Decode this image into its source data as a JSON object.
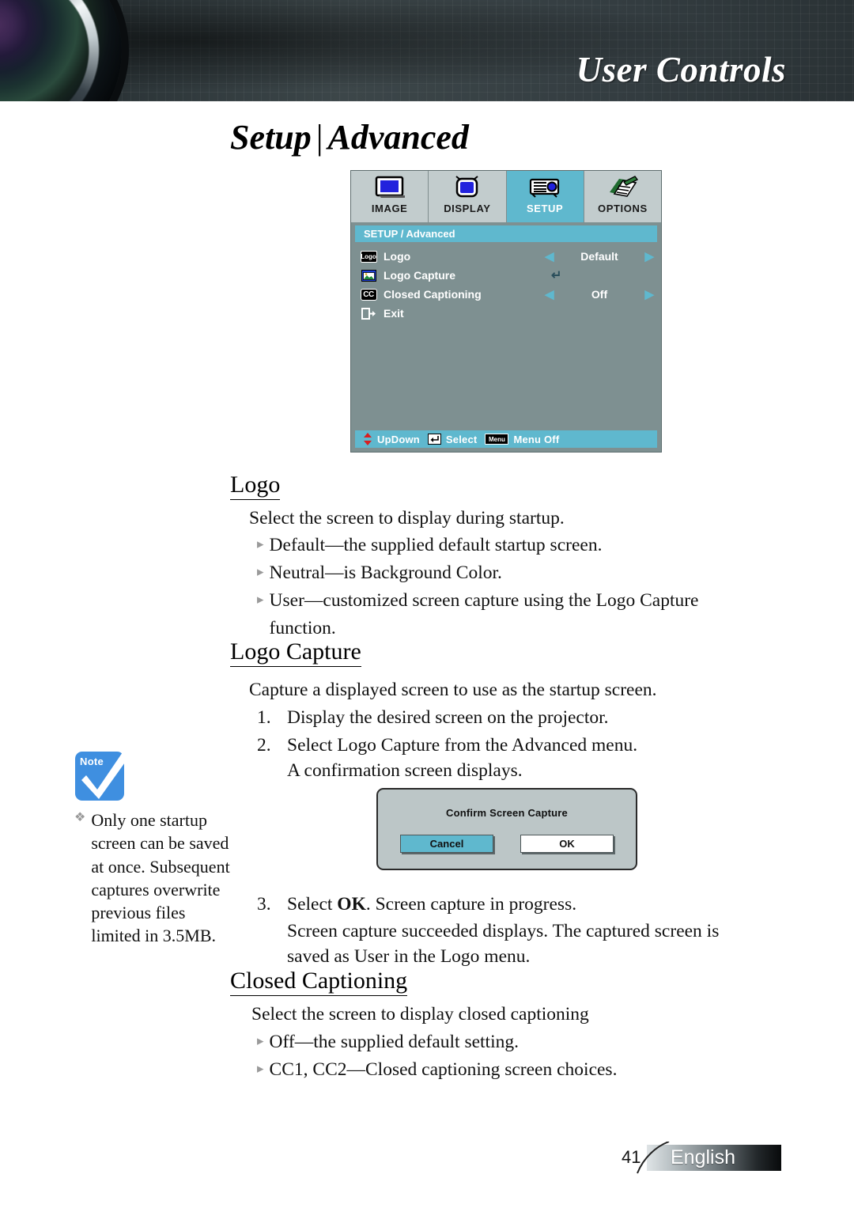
{
  "header": {
    "title": "User Controls",
    "lens_icon": "camera-lens-graphic"
  },
  "page": {
    "title_part1": "Setup",
    "title_separator": "|",
    "title_part2": "Advanced"
  },
  "osd": {
    "tabs": [
      {
        "label": "IMAGE",
        "icon": "monitor-icon",
        "active": false
      },
      {
        "label": "DISPLAY",
        "icon": "tv-icon",
        "active": false
      },
      {
        "label": "SETUP",
        "icon": "projector-icon",
        "active": true
      },
      {
        "label": "OPTIONS",
        "icon": "notes-pen-icon",
        "active": false
      }
    ],
    "breadcrumb": "SETUP / Advanced",
    "rows": [
      {
        "icon": "logo-icon",
        "label": "Logo",
        "control": "spinner",
        "value": "Default",
        "left_arrow": "◀",
        "right_arrow": "▶"
      },
      {
        "icon": "logo-capture-icon",
        "label": "Logo Capture",
        "control": "enter",
        "value": "↵"
      },
      {
        "icon": "closed-caption-icon",
        "label": "Closed Captioning",
        "control": "spinner",
        "value": "Off",
        "left_arrow": "◀",
        "right_arrow": "▶"
      },
      {
        "icon": "exit-icon",
        "label": "Exit",
        "control": "none",
        "value": ""
      }
    ],
    "footer": [
      {
        "icon": "up-down-arrows-icon",
        "label": "UpDown"
      },
      {
        "icon": "enter-key-icon",
        "label": "Select"
      },
      {
        "icon": "menu-key-icon",
        "label": "Menu Off"
      }
    ],
    "colors": {
      "accent": "#5FB8CE",
      "body": "#7E9091",
      "tab": "#C2CCCD"
    }
  },
  "sections": {
    "logo": {
      "heading": "Logo",
      "intro": "Select the screen to display during startup.",
      "bullets": [
        "Default—the supplied default startup screen.",
        "Neutral—is Background Color.",
        "User—customized screen capture using the Logo Capture function."
      ]
    },
    "logo_capture": {
      "heading": "Logo Capture",
      "intro": "Capture a displayed screen to use as the startup screen.",
      "steps": [
        {
          "num": "1.",
          "text": "Display the desired screen on the projector."
        },
        {
          "num": "2.",
          "text": "Select Logo Capture from the Advanced menu."
        },
        {
          "num": "",
          "text": "A confirmation screen displays."
        }
      ],
      "steps_after": [
        {
          "num": "3.",
          "text_pre": "Select ",
          "text_bold": "OK",
          "text_post": ". Screen capture in progress."
        },
        {
          "num": "",
          "text": "Screen capture succeeded displays. The captured screen is"
        },
        {
          "num": "",
          "text": "saved as User in the Logo menu."
        }
      ]
    },
    "closed_captioning": {
      "heading": "Closed Captioning",
      "intro": "Select the screen to display closed captioning",
      "bullets": [
        "Off—the supplied default setting.",
        "CC1, CC2—Closed captioning screen choices."
      ]
    }
  },
  "confirm_dialog": {
    "title": "Confirm Screen Capture",
    "cancel_label": "Cancel",
    "ok_label": "OK"
  },
  "note": {
    "badge_label": "Note",
    "icon": "note-checkmark-icon",
    "bullet_mark": "❖",
    "text": "Only one startup screen can be saved at once. Subsequent captures overwrite previous files limited in 3.5MB."
  },
  "footer": {
    "page_number": "41",
    "language": "English"
  }
}
